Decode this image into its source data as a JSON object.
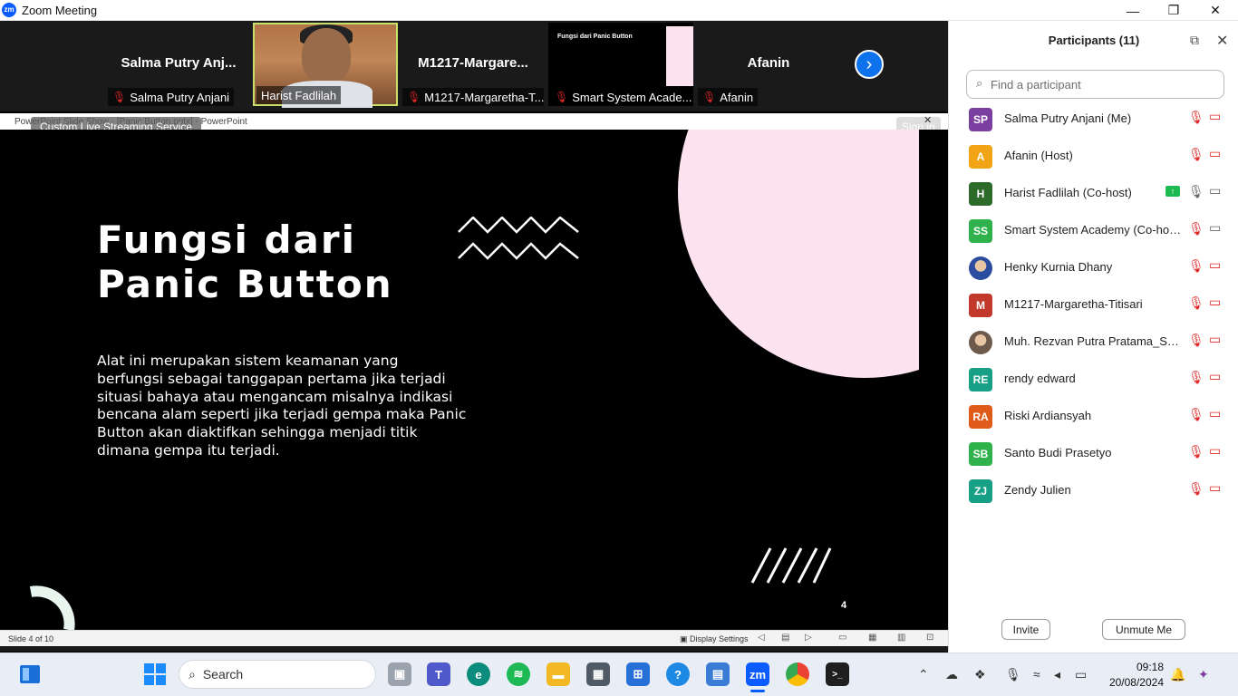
{
  "window": {
    "logo_text": "zm",
    "title": "Zoom Meeting",
    "minimize": "—",
    "restore": "❐",
    "close": "✕"
  },
  "gallery": {
    "tiles": [
      {
        "name": "Salma  Putry  Anj...",
        "label": "Salma Putry Anjani",
        "muted": true
      },
      {
        "name": "",
        "label": "Harist Fadlilah",
        "muted": false
      },
      {
        "name": "M1217-Margare...",
        "label": "M1217-Margaretha-T...",
        "muted": true
      },
      {
        "name": "",
        "label": "Smart System Acade...",
        "muted": true
      },
      {
        "name": "Afanin",
        "label": "Afanin",
        "muted": true
      }
    ],
    "screen_preview": {
      "title": "Fungsi dari Panic Button"
    }
  },
  "share": {
    "window_title": "PowerPoint Slide Show - [Panic Button.pptx] - PowerPoint",
    "live_badge": "Custom Live Streaming Service",
    "sign_in": "Sign in"
  },
  "slide": {
    "title": "Fungsi dari Panic Button",
    "body": "Alat ini merupakan sistem keamanan yang berfungsi sebagai tanggapan pertama jika terjadi situasi bahaya atau mengancam misalnya indikasi bencana alam seperti jika terjadi gempa maka Panic Button akan diaktifkan sehingga menjadi titik dimana gempa itu terjadi.",
    "page_number": "4",
    "colors": {
      "background": "#000000",
      "accent_circle": "#fde3ef"
    }
  },
  "ppt_status": {
    "slide_of": "Slide 4 of 10",
    "display_settings": "Display Settings"
  },
  "participants": {
    "title": "Participants (11)",
    "search_placeholder": "Find a participant",
    "list": [
      {
        "initials": "SP",
        "color": "#7b3fa0",
        "name": "Salma Putry Anjani (Me)",
        "mic": "off",
        "cam": "off"
      },
      {
        "initials": "A",
        "color": "#f0a416",
        "name": "Afanin (Host)",
        "mic": "off",
        "cam": "off"
      },
      {
        "initials": "H",
        "color": "#2e6b2b",
        "name": "Harist Fadlilah (Co-host)",
        "mic": "on",
        "cam": "on",
        "sharing": true
      },
      {
        "initials": "SS",
        "color": "#2fb24c",
        "name": "Smart System Academy (Co-host)",
        "mic": "off",
        "cam": "on"
      },
      {
        "initials": "",
        "color": "#2c4ca0",
        "name": "Henky Kurnia Dhany",
        "mic": "off",
        "cam": "off",
        "photo": true
      },
      {
        "initials": "M",
        "color": "#c0392b",
        "name": "M1217-Margaretha-Titisari",
        "mic": "off",
        "cam": "off"
      },
      {
        "initials": "",
        "color": "#6d5a4a",
        "name": "Muh. Rezvan Putra Pratama_SM...",
        "mic": "off",
        "cam": "off",
        "photo": true
      },
      {
        "initials": "RE",
        "color": "#17a085",
        "name": "rendy edward",
        "mic": "off",
        "cam": "off"
      },
      {
        "initials": "RA",
        "color": "#e05a1a",
        "name": "Riski Ardiansyah",
        "mic": "off",
        "cam": "off"
      },
      {
        "initials": "SB",
        "color": "#2fb24c",
        "name": "Santo Budi Prasetyo",
        "mic": "off",
        "cam": "off"
      },
      {
        "initials": "ZJ",
        "color": "#17a085",
        "name": "Zendy Julien",
        "mic": "off",
        "cam": "off"
      }
    ],
    "invite_label": "Invite",
    "unmute_label": "Unmute Me"
  },
  "taskbar": {
    "search_label": "Search",
    "time": "09:18",
    "date": "20/08/2024"
  }
}
